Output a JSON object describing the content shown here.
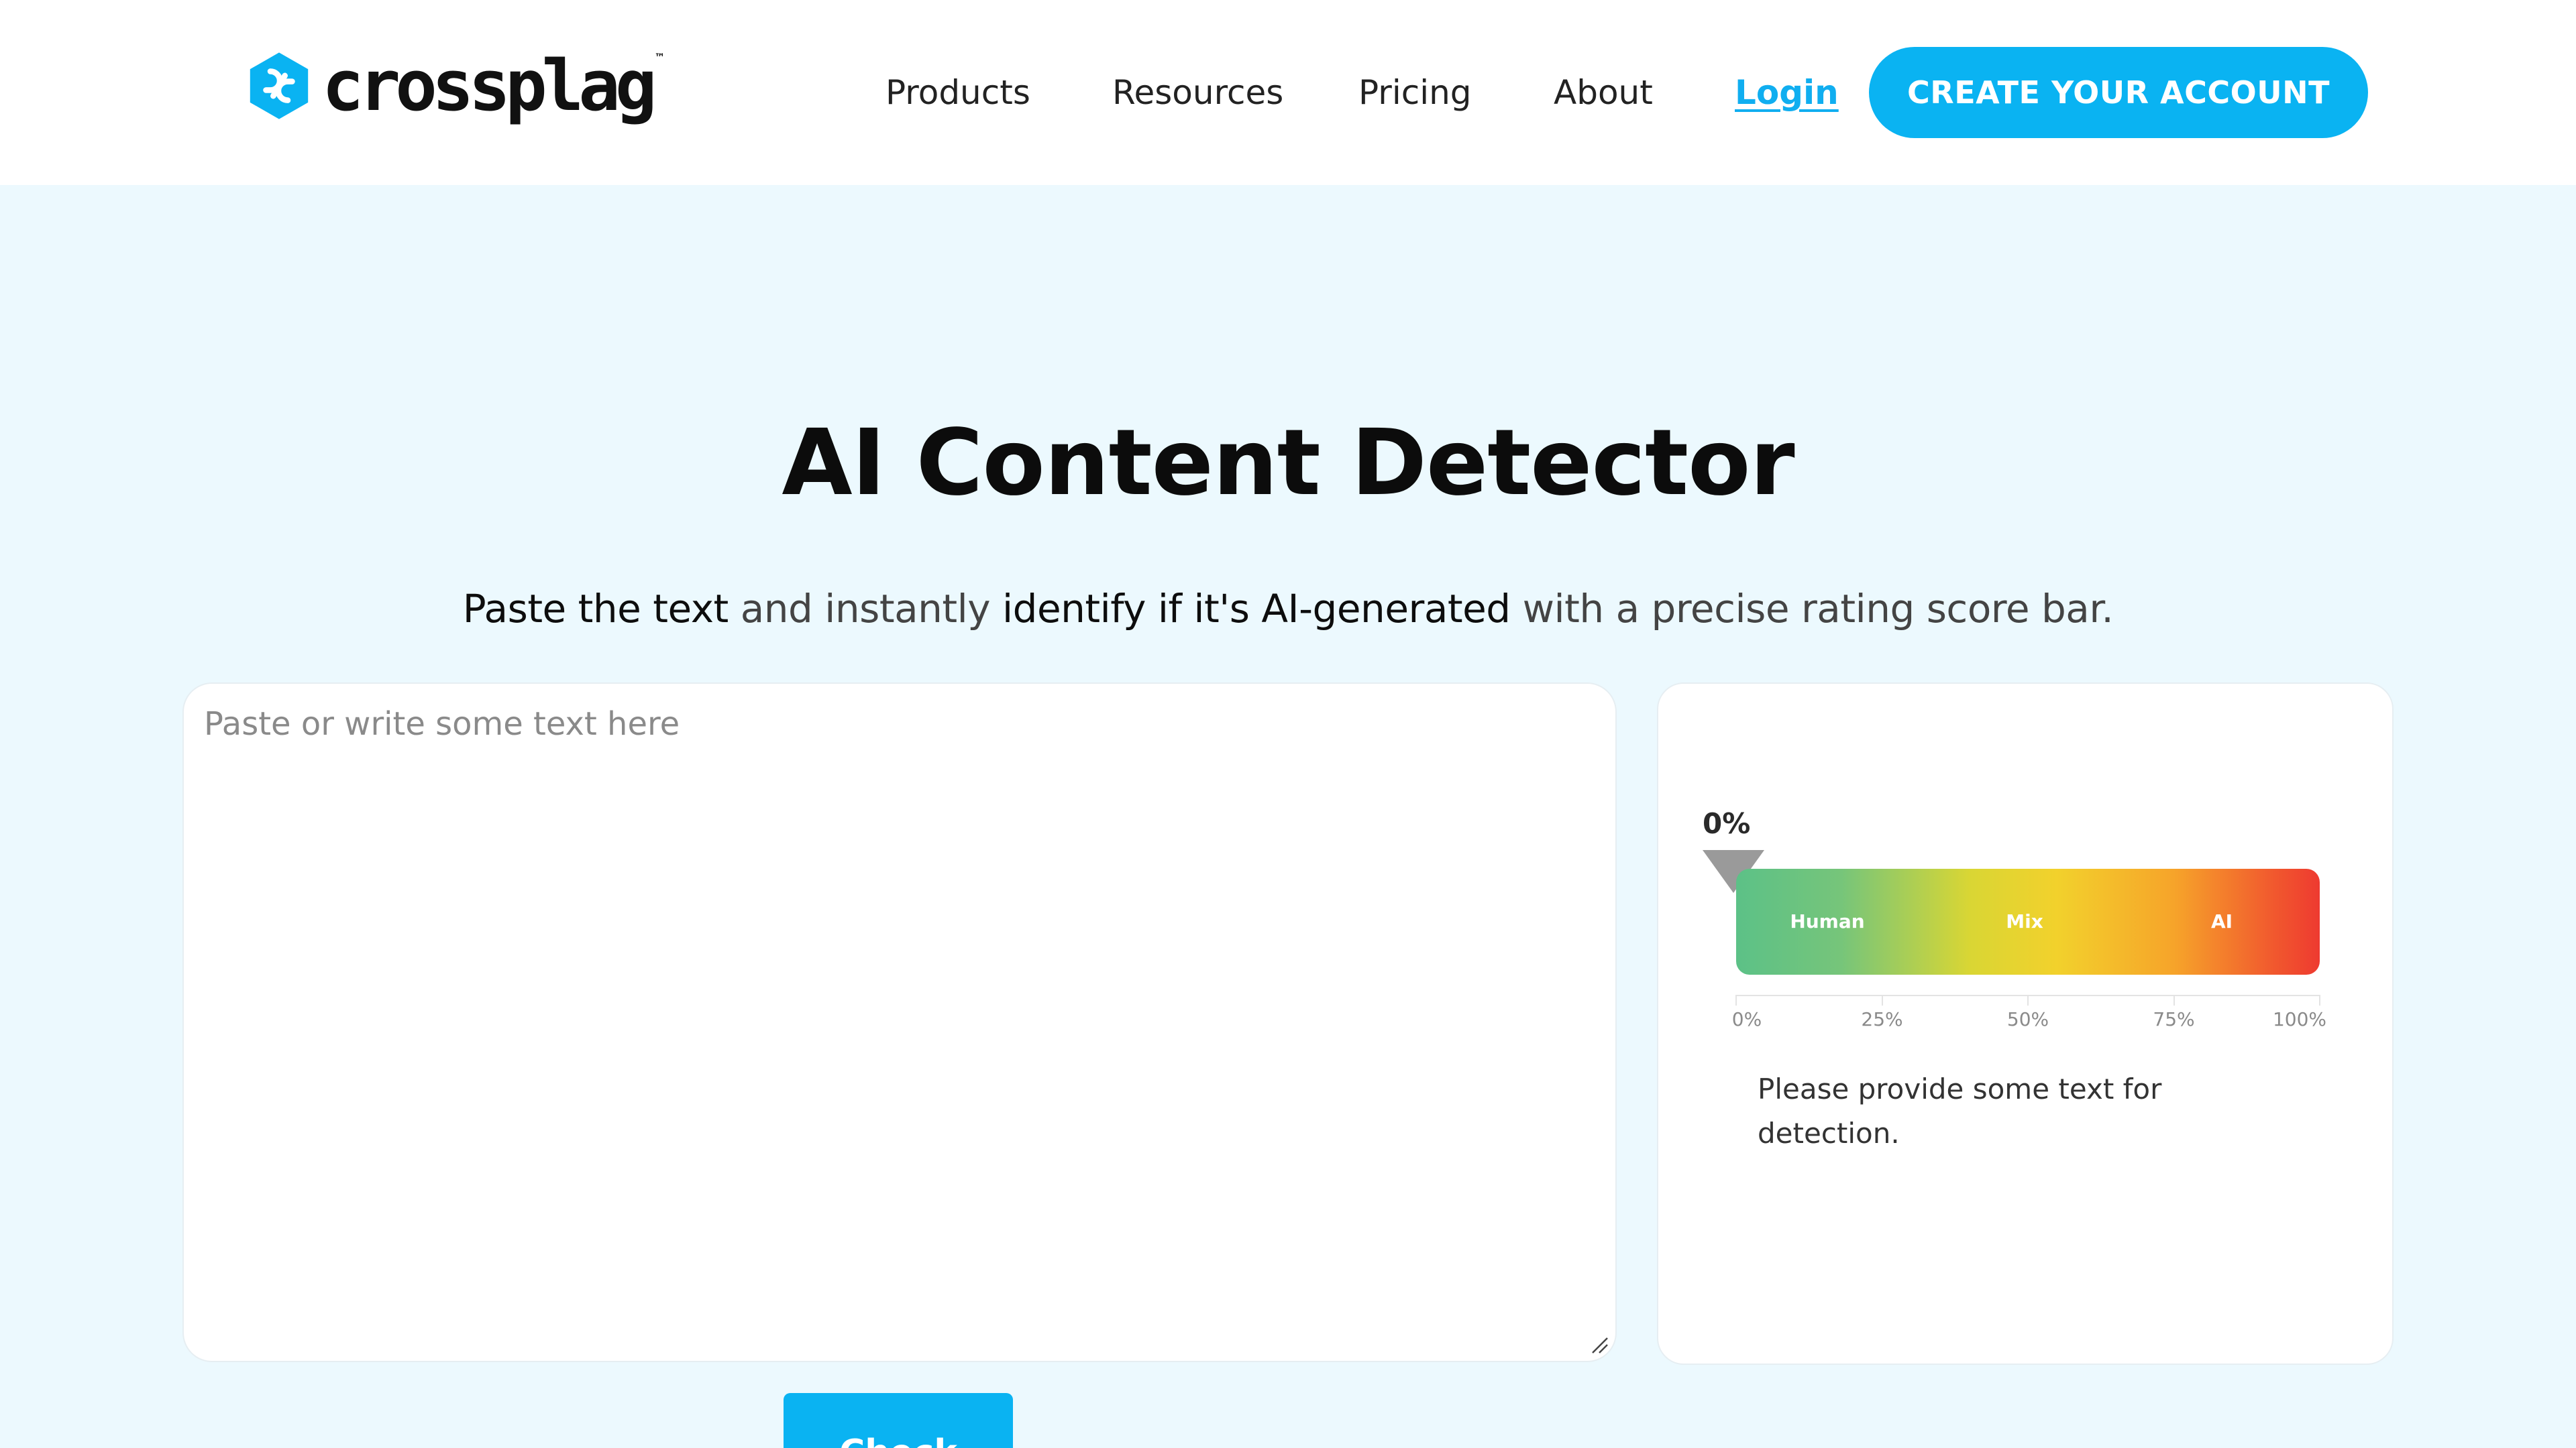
{
  "brand": {
    "name": "crossplag",
    "trademark": "™",
    "color": "#0ab3f2"
  },
  "nav": {
    "items": [
      "Products",
      "Resources",
      "Pricing",
      "About"
    ],
    "login": "Login",
    "cta": "CREATE YOUR ACCOUNT"
  },
  "hero": {
    "title": "AI Content Detector",
    "subtitle": {
      "part1": "Paste the text",
      "part2": " and instantly ",
      "part3": "identify if it's AI-generated",
      "part4": " with a precise rating score bar."
    }
  },
  "input": {
    "placeholder": "Paste or write some text here",
    "value": ""
  },
  "check_button": "Check",
  "result": {
    "score_label": "0%",
    "score_fraction": 0,
    "zones": [
      "Human",
      "Mix",
      "AI"
    ],
    "scale": [
      "0%",
      "25%",
      "50%",
      "75%",
      "100%"
    ],
    "message": "Please provide some text for detection.",
    "colors": {
      "human": "#5cc187",
      "mix": "#f2d12c",
      "ai": "#ee3a30"
    }
  },
  "icons": {
    "logo": "crossplag-logo-icon",
    "marker": "score-marker-icon",
    "resize": "resize-handle-icon"
  }
}
